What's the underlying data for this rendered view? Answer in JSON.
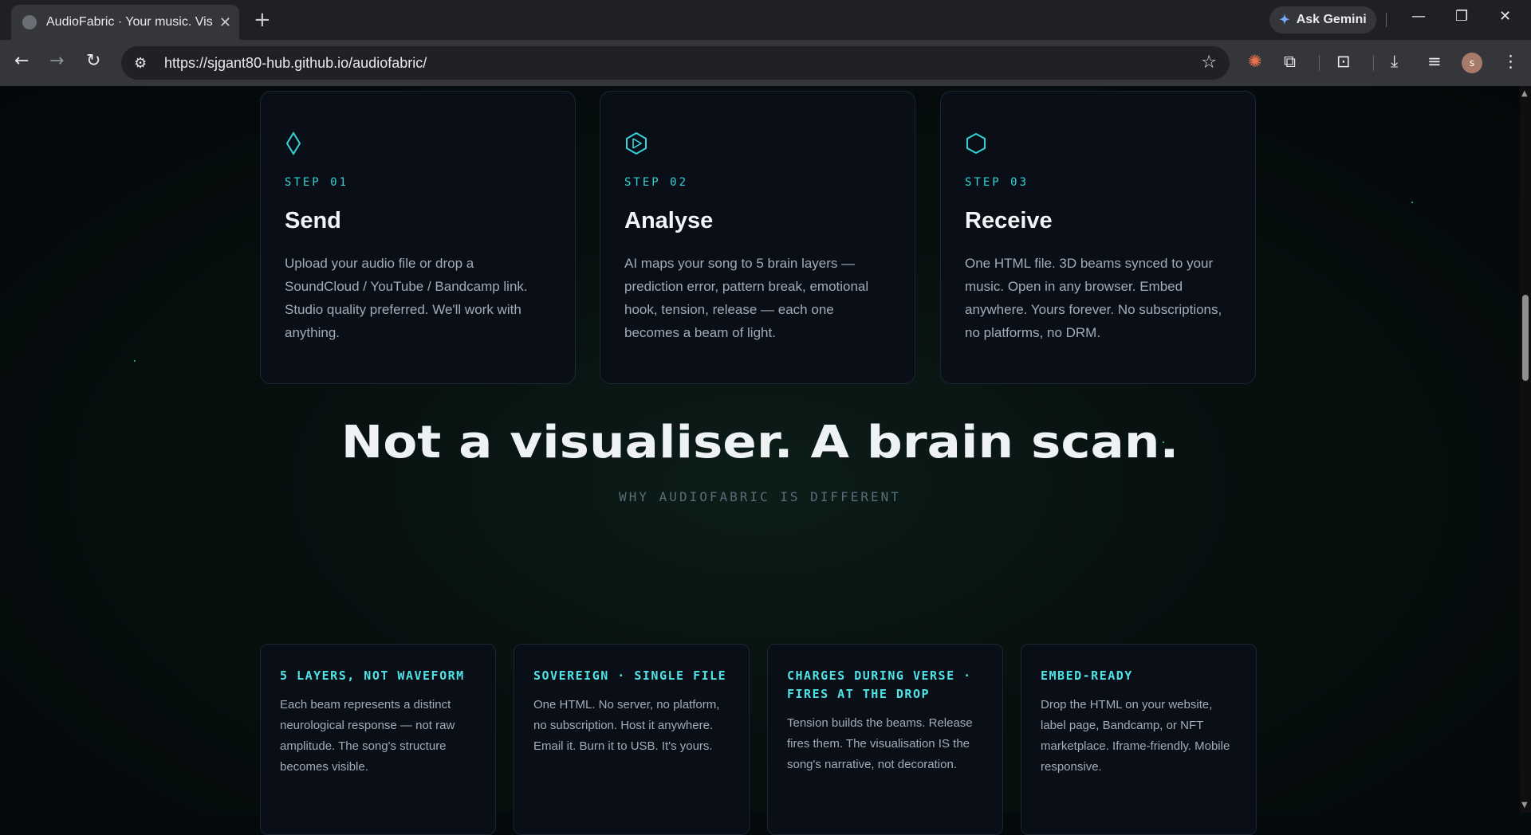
{
  "browser": {
    "tab_title": "AudioFabric · Your music. Visual",
    "url": "https://sjgant80-hub.github.io/audiofabric/",
    "gemini_label": "Ask Gemini",
    "profile_initial": "s"
  },
  "icons": {
    "step1": "diamond-icon",
    "step2": "hexagon-play-icon",
    "step3": "hexagon-icon"
  },
  "accent_color": "#35d3d7",
  "steps": [
    {
      "label": "STEP 01",
      "title": "Send",
      "description": "Upload your audio file or drop a SoundCloud / YouTube / Bandcamp link. Studio quality preferred. We'll work with anything."
    },
    {
      "label": "STEP 02",
      "title": "Analyse",
      "description": "AI maps your song to 5 brain layers — prediction error, pattern break, emotional hook, tension, release — each one becomes a beam of light."
    },
    {
      "label": "STEP 03",
      "title": "Receive",
      "description": "One HTML file. 3D beams synced to your music. Open in any browser. Embed anywhere. Yours forever. No subscriptions, no platforms, no DRM."
    }
  ],
  "section": {
    "headline": "Not a visualiser. A brain scan.",
    "subheading": "WHY AUDIOFABRIC IS DIFFERENT"
  },
  "features": [
    {
      "title": "5 LAYERS, NOT WAVEFORM",
      "description": "Each beam represents a distinct neurological response — not raw amplitude. The song's structure becomes visible."
    },
    {
      "title": "SOVEREIGN · SINGLE FILE",
      "description": "One HTML. No server, no platform, no subscription. Host it anywhere. Email it. Burn it to USB. It's yours."
    },
    {
      "title": "CHARGES DURING VERSE · FIRES AT THE DROP",
      "description": "Tension builds the beams. Release fires them. The visualisation IS the song's narrative, not decoration."
    },
    {
      "title": "EMBED-READY",
      "description": "Drop the HTML on your website, label page, Bandcamp, or NFT marketplace. Iframe-friendly. Mobile responsive."
    }
  ]
}
